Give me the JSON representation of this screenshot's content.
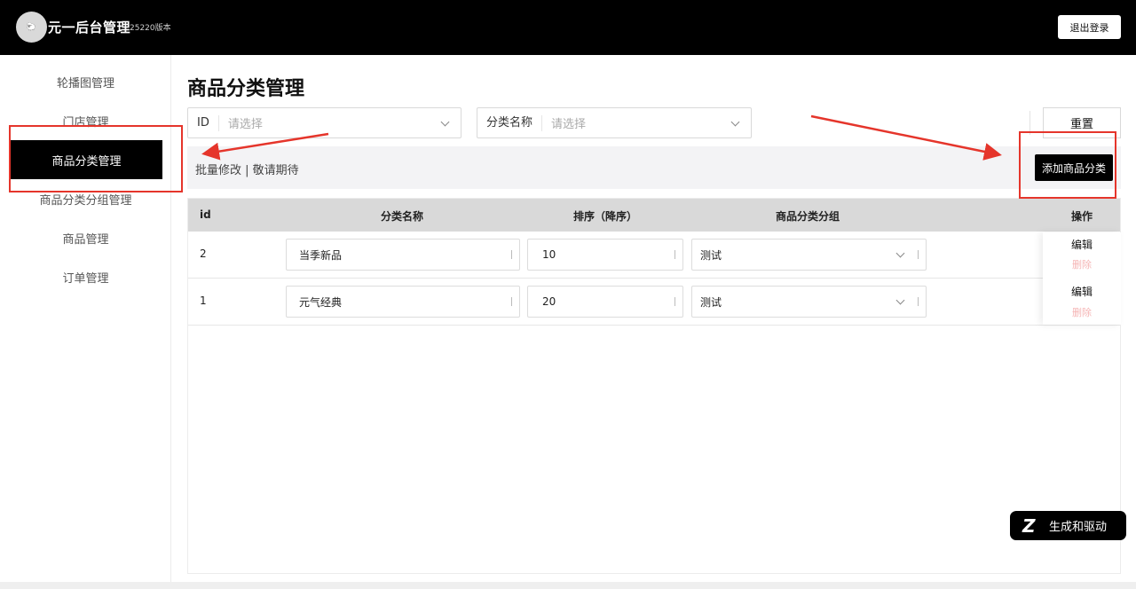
{
  "header": {
    "logo_text": "🐑",
    "app_title": "元一后台管理",
    "version": "25220版本",
    "logout_label": "退出登录"
  },
  "sidebar": {
    "items": [
      {
        "label": "轮播图管理"
      },
      {
        "label": "门店管理"
      },
      {
        "label": "商品分类管理",
        "active": true
      },
      {
        "label": "商品分类分组管理"
      },
      {
        "label": "商品管理"
      },
      {
        "label": "订单管理"
      }
    ]
  },
  "main": {
    "title": "商品分类管理",
    "filters": [
      {
        "label": "ID",
        "placeholder": "请选择"
      },
      {
        "label": "分类名称",
        "placeholder": "请选择"
      }
    ],
    "reset_label": "重置",
    "toolbar_text": "批量修改 | 敬请期待",
    "add_label": "添加商品分类",
    "table": {
      "headers": [
        "id",
        "分类名称",
        "排序（降序）",
        "商品分类分组",
        "操作"
      ],
      "rows": [
        {
          "id": "2",
          "name": "当季新品",
          "sort": "10",
          "group": "测试"
        },
        {
          "id": "1",
          "name": "元气经典",
          "sort": "20",
          "group": "测试"
        }
      ],
      "edit_label": "编辑",
      "delete_label": "删除"
    }
  },
  "float_badge": {
    "icon": "Z",
    "label": "生成和驱动"
  },
  "colors": {
    "header_bg": "#000000",
    "accent": "#000000",
    "annotation": "#e5352b",
    "delete_text": "#f5b5b5"
  }
}
